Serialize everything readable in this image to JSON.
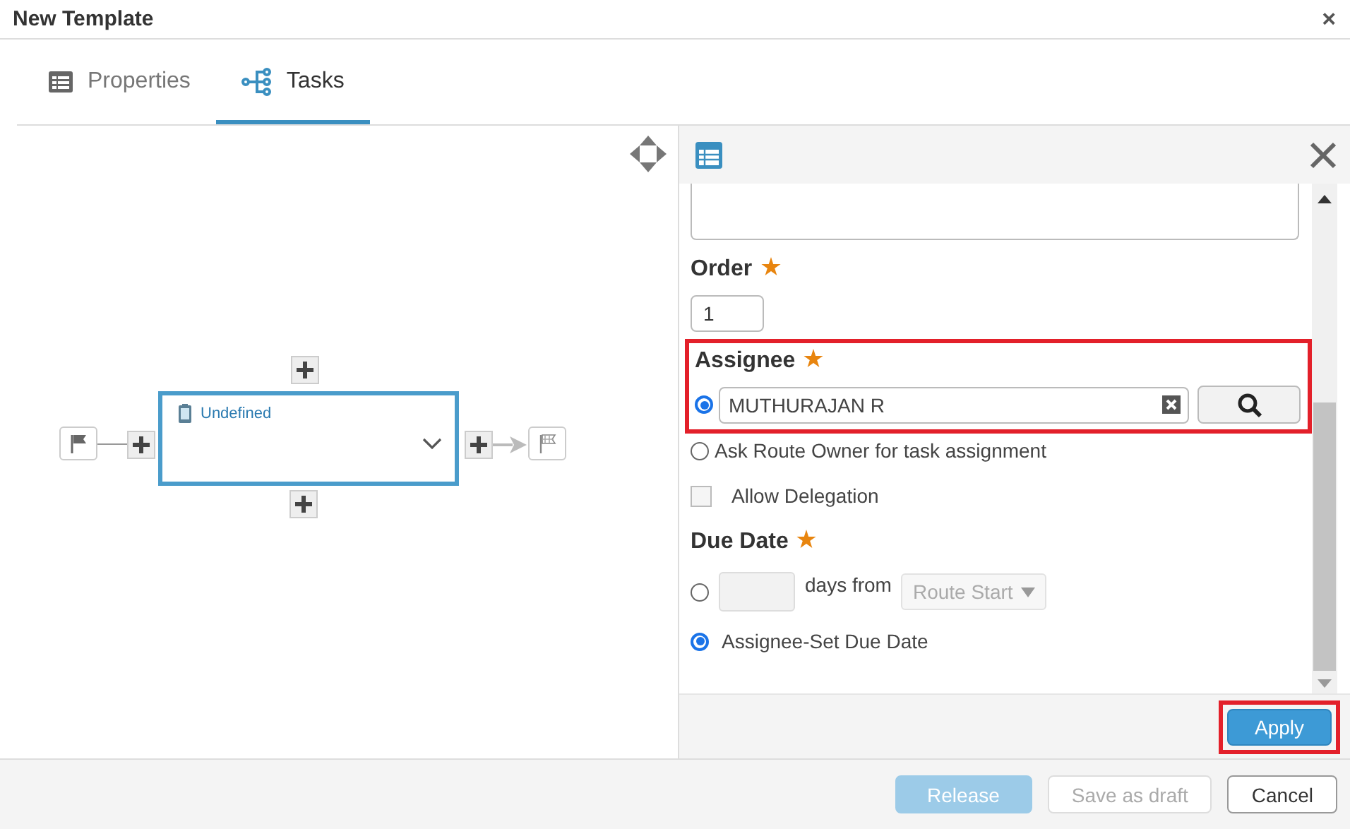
{
  "window": {
    "title": "New Template",
    "close": "×"
  },
  "tabs": [
    {
      "label": "Properties",
      "kind": "properties",
      "selected": false
    },
    {
      "label": "Tasks",
      "kind": "tasks",
      "selected": true
    }
  ],
  "diagram": {
    "task": {
      "title": "Undefined"
    }
  },
  "panel": {
    "order": {
      "label": "Order",
      "required": true,
      "value": "1"
    },
    "assignee": {
      "label": "Assignee",
      "required": true,
      "highlighted": true,
      "user": "MUTHURAJAN R",
      "user_selected": true,
      "route_owner": {
        "label": "Ask Route Owner for task assignment",
        "selected": false
      }
    },
    "delegation": {
      "label": "Allow Delegation",
      "checked": false
    },
    "due_date": {
      "label": "Due Date",
      "required": true,
      "options": [
        {
          "kind": "days",
          "label": "days from",
          "dropdown": "Route Start",
          "selected": false
        },
        {
          "kind": "text",
          "label": "Assignee-Set Due Date",
          "selected": true
        }
      ]
    },
    "apply": {
      "label": "Apply",
      "highlighted": true
    }
  },
  "buttons": [
    {
      "label": "Release",
      "kind": "primary",
      "disabled": true
    },
    {
      "label": "Save as draft",
      "kind": "default",
      "disabled": true
    },
    {
      "label": "Cancel",
      "kind": "default",
      "disabled": false
    }
  ]
}
